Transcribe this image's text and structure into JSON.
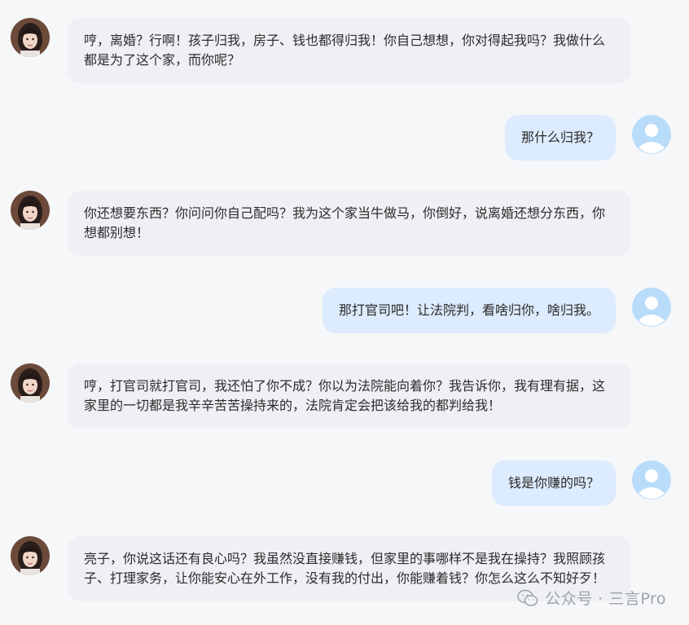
{
  "messages": [
    {
      "side": "left",
      "text": "哼，离婚？行啊！孩子归我，房子、钱也都得归我！你自己想想，你对得起我吗？我做什么都是为了这个家，而你呢？"
    },
    {
      "side": "right",
      "text": "那什么归我？"
    },
    {
      "side": "left",
      "text": "你还想要东西？你问问你自己配吗？我为这个家当牛做马，你倒好，说离婚还想分东西，你想都别想！"
    },
    {
      "side": "right",
      "text": "那打官司吧！让法院判，看啥归你，啥归我。"
    },
    {
      "side": "left",
      "text": "哼，打官司就打官司，我还怕了你不成？你以为法院能向着你？我告诉你，我有理有据，这家里的一切都是我辛辛苦苦操持来的，法院肯定会把该给我的都判给我！"
    },
    {
      "side": "right",
      "text": "钱是你赚的吗？"
    },
    {
      "side": "left",
      "text": "亮子，你说这话还有良心吗？我虽然没直接赚钱，但家里的事哪样不是我在操持？我照顾孩子、打理家务，让你能安心在外工作，没有我的付出，你能赚着钱？你怎么这么不知好歹！"
    }
  ],
  "watermark": {
    "text": "公众号 · 三言Pro",
    "icon": "wechat-icon"
  },
  "colors": {
    "background": "#f6f7f9",
    "left_bubble": "#eef0f4",
    "right_bubble": "#dcebfd",
    "user_avatar": "#b9dcfb"
  }
}
